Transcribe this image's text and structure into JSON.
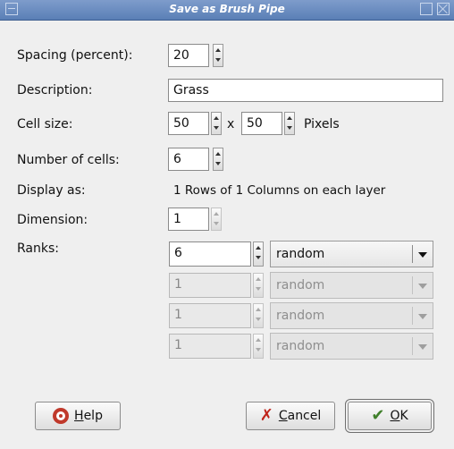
{
  "window": {
    "title": "Save as Brush Pipe"
  },
  "spacing": {
    "label": "Spacing (percent):",
    "value": "20"
  },
  "description": {
    "label": "Description:",
    "value": "Grass"
  },
  "cell_size": {
    "label": "Cell size:",
    "width": "50",
    "x_sep": "x",
    "height": "50",
    "unit": "Pixels"
  },
  "num_cells": {
    "label": "Number of cells:",
    "value": "6"
  },
  "display_as": {
    "label": "Display as:",
    "value": "1 Rows of  1 Columns on each layer"
  },
  "dimension": {
    "label": "Dimension:",
    "value": "1"
  },
  "ranks": {
    "label": "Ranks:",
    "rows": [
      {
        "value": "6",
        "mode": "random",
        "enabled": true
      },
      {
        "value": "1",
        "mode": "random",
        "enabled": false
      },
      {
        "value": "1",
        "mode": "random",
        "enabled": false
      },
      {
        "value": "1",
        "mode": "random",
        "enabled": false
      }
    ]
  },
  "buttons": {
    "help": {
      "pre": "",
      "mn": "H",
      "post": "elp",
      "icon": "help-icon"
    },
    "cancel": {
      "pre": "",
      "mn": "C",
      "post": "ancel",
      "icon": "cancel-icon"
    },
    "ok": {
      "pre": "",
      "mn": "O",
      "post": "K",
      "icon": "ok-icon"
    }
  }
}
